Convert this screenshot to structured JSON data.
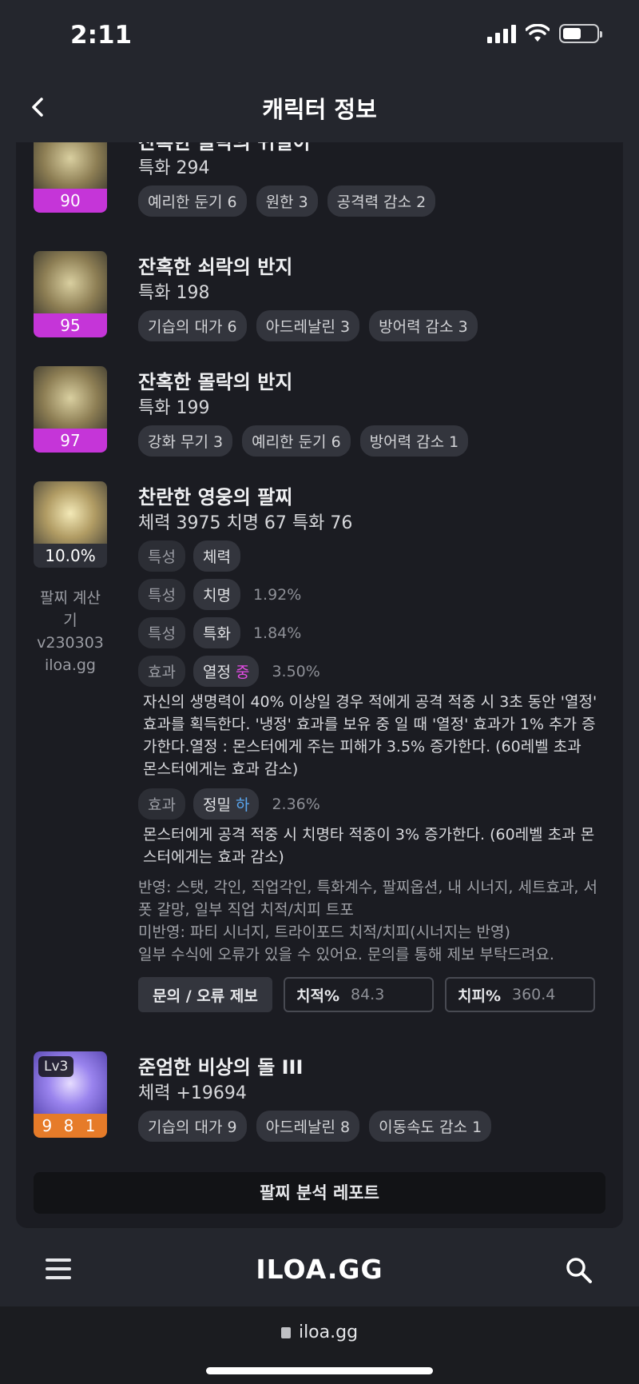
{
  "status": {
    "time": "2:11"
  },
  "header": {
    "title": "캐릭터 정보"
  },
  "items": [
    {
      "name": "잔혹한 몰락의 귀걸이",
      "stat": "특화 294",
      "badge": "90",
      "tags": [
        "예리한 둔기 6",
        "원한 3",
        "공격력 감소 2"
      ]
    },
    {
      "name": "잔혹한 쇠락의 반지",
      "stat": "특화 198",
      "badge": "95",
      "tags": [
        "기습의 대가 6",
        "아드레날린 3",
        "방어력 감소 3"
      ]
    },
    {
      "name": "잔혹한 몰락의 반지",
      "stat": "특화 199",
      "badge": "97",
      "tags": [
        "강화 무기 3",
        "예리한 둔기 6",
        "방어력 감소 1"
      ]
    }
  ],
  "bracelet": {
    "name": "찬란한 영웅의 팔찌",
    "stat": "체력 3975  치명 67  특화 76",
    "badge": "10.0%",
    "calc_label": [
      "팔찌 계산기",
      "v230303",
      "iloa.gg"
    ],
    "options": [
      {
        "kind": "특성",
        "value": "체력",
        "pct": ""
      },
      {
        "kind": "특성",
        "value": "치명",
        "pct": "1.92%"
      },
      {
        "kind": "특성",
        "value": "특화",
        "pct": "1.84%"
      },
      {
        "kind": "효과",
        "value": "열정",
        "grade": "중",
        "pct": "3.50%",
        "desc": "자신의 생명력이 40% 이상일 경우 적에게 공격 적중 시 3초 동안 '열정' 효과를 획득한다. '냉정' 효과를 보유 중 일 때 '열정' 효과가 1% 추가 증가한다.열정 : 몬스터에게 주는 피해가 3.5% 증가한다. (60레벨 초과 몬스터에게는 효과 감소)"
      },
      {
        "kind": "효과",
        "value": "정밀",
        "grade": "하",
        "pct": "2.36%",
        "desc": "몬스터에게 공격 적중 시 치명타 적중이 3% 증가한다. (60레벨 초과 몬스터에게는 효과 감소)"
      }
    ],
    "notes": [
      "반영: 스탯, 각인, 직업각인, 특화계수, 팔찌옵션, 내 시너지, 세트효과, 서폿 갈망, 일부 직업 치적/치피 트포",
      "미반영: 파티 시너지, 트라이포드 치적/치피(시너지는 반영)",
      "일부 수식에 오류가 있을 수 있어요. 문의를 통해 제보 부탁드려요."
    ],
    "report_label": "문의 / 오류 제보",
    "crit_rate_label": "치적%",
    "crit_rate_value": "84.3",
    "crit_dmg_label": "치피%",
    "crit_dmg_value": "360.4"
  },
  "stone": {
    "name": "준엄한 비상의 돌 III",
    "stat": "체력 +19694",
    "level": "Lv3",
    "badge": "9 8 1",
    "tags": [
      "기습의 대가 9",
      "아드레날린 8",
      "이동속도 감소 1"
    ]
  },
  "analysis_button": "팔찌 분석 레포트",
  "bottom_nav": {
    "logo": "ILOA.GG"
  },
  "browser": {
    "url": "iloa.gg"
  }
}
